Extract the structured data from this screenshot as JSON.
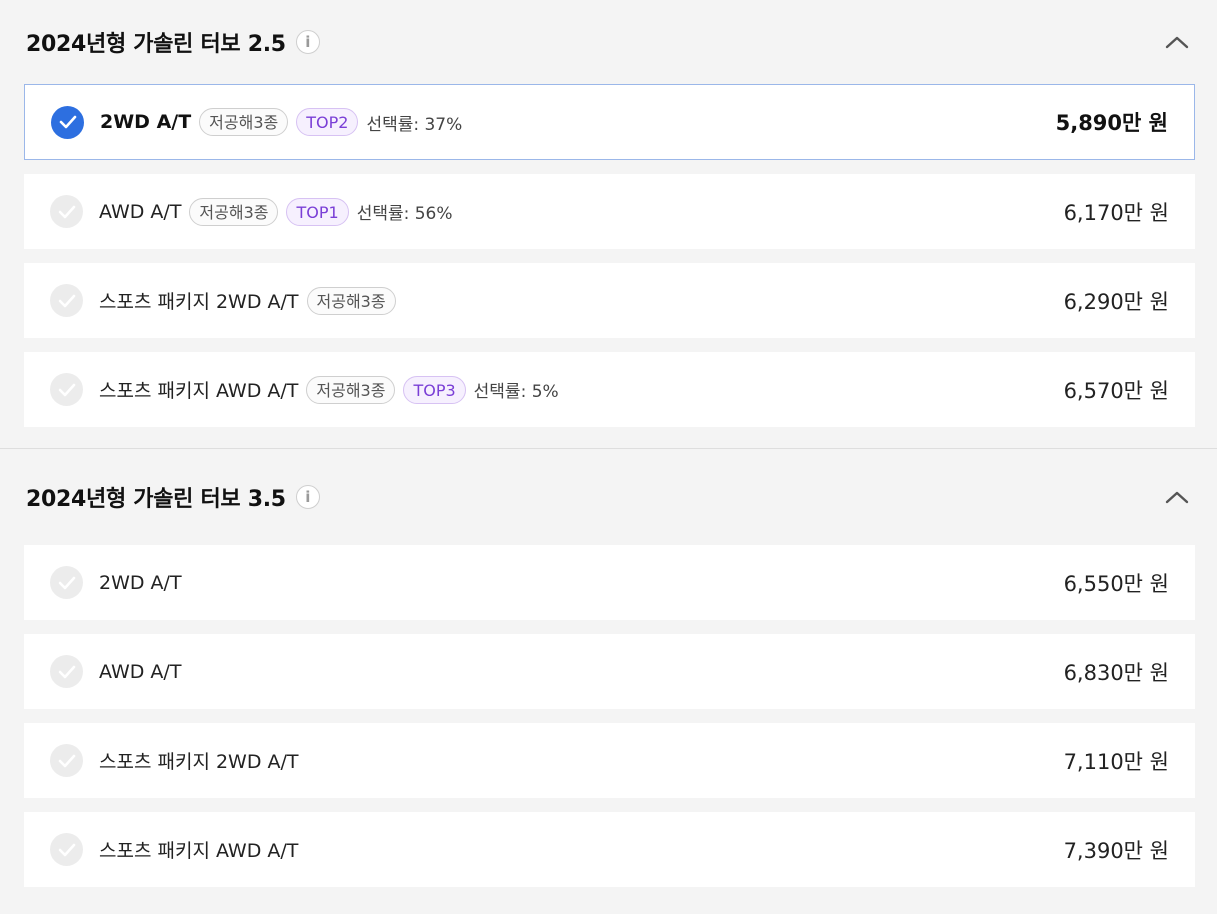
{
  "sections": [
    {
      "title": "2024년형 가솔린 터보 2.5",
      "info_icon": "info-icon",
      "toggle_icon": "chevron-up-icon",
      "options": [
        {
          "name": "2WD A/T",
          "badge": "저공해3종",
          "top": "TOP2",
          "rate": "선택률: 37%",
          "price": "5,890만 원",
          "selected": true
        },
        {
          "name": "AWD A/T",
          "badge": "저공해3종",
          "top": "TOP1",
          "rate": "선택률: 56%",
          "price": "6,170만 원",
          "selected": false
        },
        {
          "name": "스포츠 패키지 2WD A/T",
          "badge": "저공해3종",
          "top": null,
          "rate": null,
          "price": "6,290만 원",
          "selected": false
        },
        {
          "name": "스포츠 패키지 AWD A/T",
          "badge": "저공해3종",
          "top": "TOP3",
          "rate": "선택률: 5%",
          "price": "6,570만 원",
          "selected": false
        }
      ]
    },
    {
      "title": "2024년형 가솔린 터보 3.5",
      "info_icon": "info-icon",
      "toggle_icon": "chevron-up-icon",
      "options": [
        {
          "name": "2WD A/T",
          "badge": null,
          "top": null,
          "rate": null,
          "price": "6,550만 원",
          "selected": false
        },
        {
          "name": "AWD A/T",
          "badge": null,
          "top": null,
          "rate": null,
          "price": "6,830만 원",
          "selected": false
        },
        {
          "name": "스포츠 패키지 2WD A/T",
          "badge": null,
          "top": null,
          "rate": null,
          "price": "7,110만 원",
          "selected": false
        },
        {
          "name": "스포츠 패키지 AWD A/T",
          "badge": null,
          "top": null,
          "rate": null,
          "price": "7,390만 원",
          "selected": false
        }
      ]
    }
  ],
  "colors": {
    "accent": "#2d6fe0",
    "top_badge": "#7a3fd6",
    "selected_border": "#9bb7e9"
  }
}
